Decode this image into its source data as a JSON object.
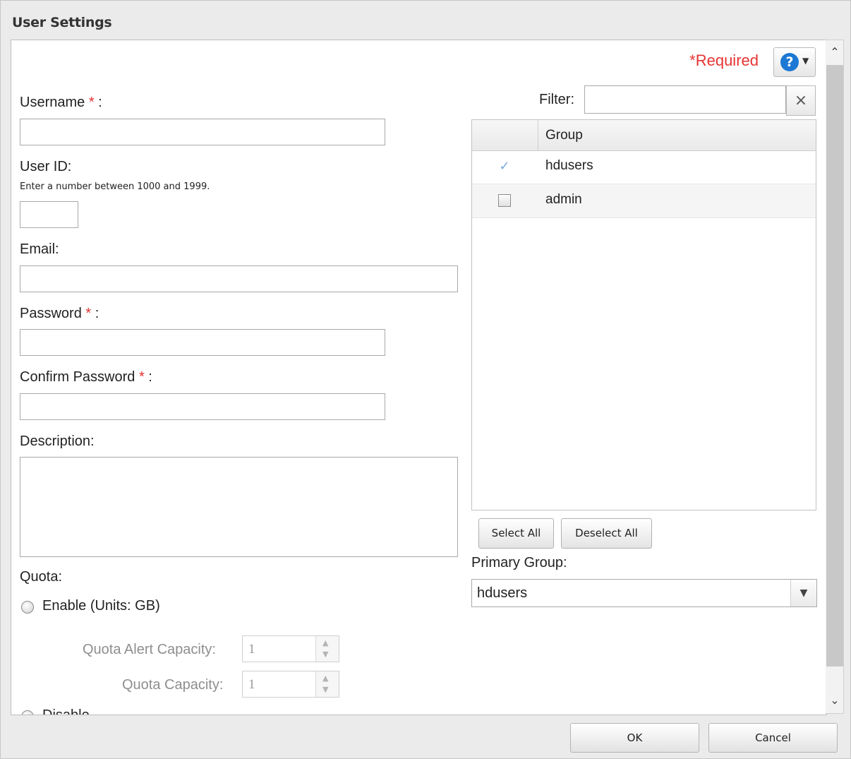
{
  "dialog": {
    "title": "User Settings"
  },
  "header": {
    "required_note": "*Required",
    "help_icon": "?"
  },
  "form": {
    "username": {
      "label": "Username",
      "star": "*",
      "suffix": " :",
      "value": ""
    },
    "user_id": {
      "label": "User ID:",
      "hint": "Enter a number between 1000 and 1999.",
      "value": ""
    },
    "email": {
      "label": "Email:",
      "value": ""
    },
    "password": {
      "label": "Password",
      "star": "*",
      "suffix": " :",
      "value": ""
    },
    "confirm_password": {
      "label": "Confirm Password",
      "star": "*",
      "suffix": " :",
      "value": ""
    },
    "description": {
      "label": "Description:",
      "value": ""
    },
    "quota": {
      "label": "Quota:",
      "enable_label": "Enable (Units: GB)",
      "alert_capacity_label": "Quota Alert Capacity:",
      "alert_capacity_value": "1",
      "capacity_label": "Quota Capacity:",
      "capacity_value": "1",
      "disable_label": "Disable"
    }
  },
  "groups": {
    "filter_label": "Filter:",
    "filter_value": "",
    "column_header": "Group",
    "rows": [
      {
        "name": "hdusers",
        "checked": true
      },
      {
        "name": "admin",
        "checked": false
      }
    ],
    "select_all_label": "Select All",
    "deselect_all_label": "Deselect All",
    "primary_group_label": "Primary Group:",
    "primary_group_value": "hdusers"
  },
  "footer": {
    "ok_label": "OK",
    "cancel_label": "Cancel"
  },
  "colors": {
    "required": "#e63333",
    "help_icon": "#1c78d4"
  }
}
